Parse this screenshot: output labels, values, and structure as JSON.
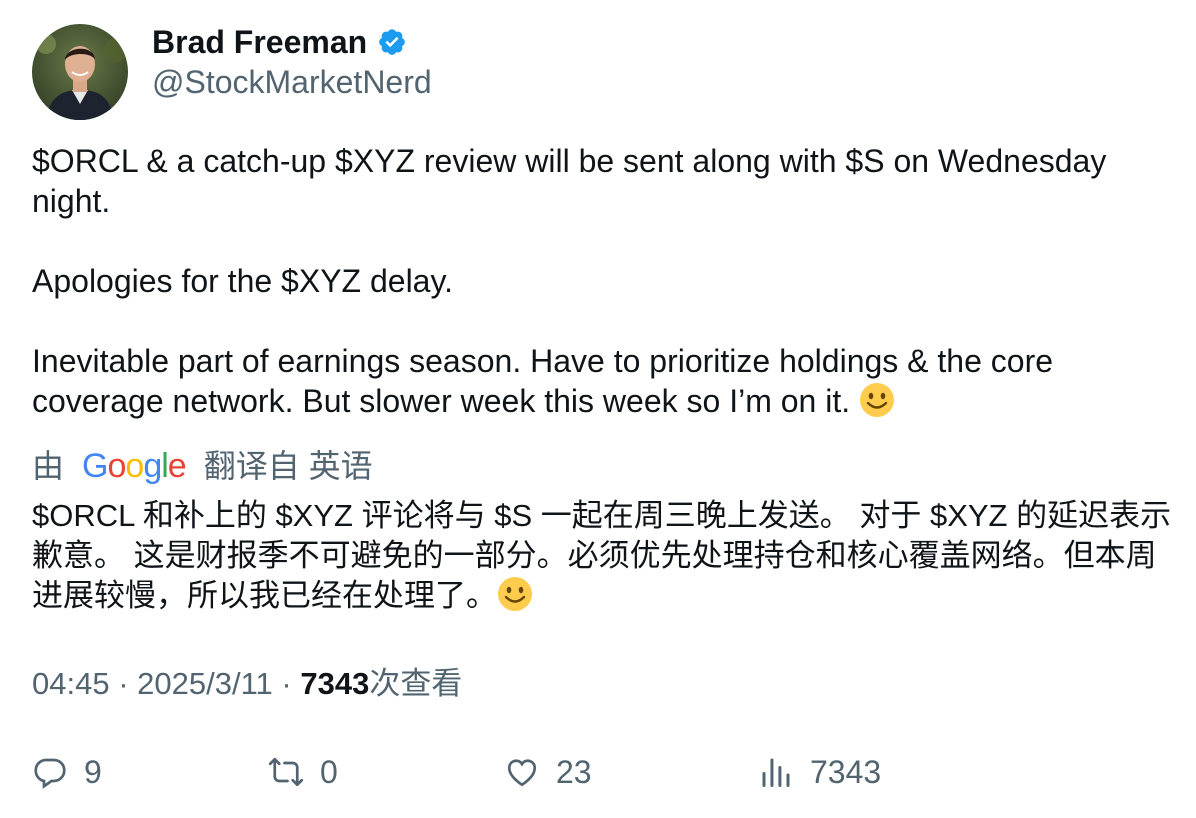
{
  "author": {
    "display_name": "Brad Freeman",
    "handle": "@StockMarketNerd",
    "verified": true
  },
  "tweet": {
    "paragraphs": [
      "$ORCL & a catch-up $XYZ review will be sent along with $S on Wednesday night.",
      "Apologies for the $XYZ delay.",
      "Inevitable part of earnings season. Have to prioritize holdings & the core coverage network. But slower week this week so I’m on it."
    ],
    "emoji": "slightly-smiling-face"
  },
  "translation": {
    "prefix": "由",
    "provider": "Google",
    "suffix": "翻译自 英语",
    "text": "$ORCL 和补上的 $XYZ 评论将与 $S 一起在周三晚上发送。 对于 $XYZ 的延迟表示歉意。 这是财报季不可避免的一部分。必须优先处理持仓和核心覆盖网络。但本周进展较慢，所以我已经在处理了。"
  },
  "meta": {
    "time": "04:45",
    "separator": "·",
    "date": "2025/3/11",
    "views_count": "7343",
    "views_label": "次查看"
  },
  "actions": {
    "replies": "9",
    "retweets": "0",
    "likes": "23",
    "views": "7343"
  },
  "colors": {
    "text_primary": "#0f1419",
    "text_secondary": "#536471",
    "verified_blue": "#1d9bf0",
    "google_blue": "#4285f4",
    "google_red": "#ea4335",
    "google_yellow": "#fbbc05",
    "google_green": "#34a853"
  }
}
